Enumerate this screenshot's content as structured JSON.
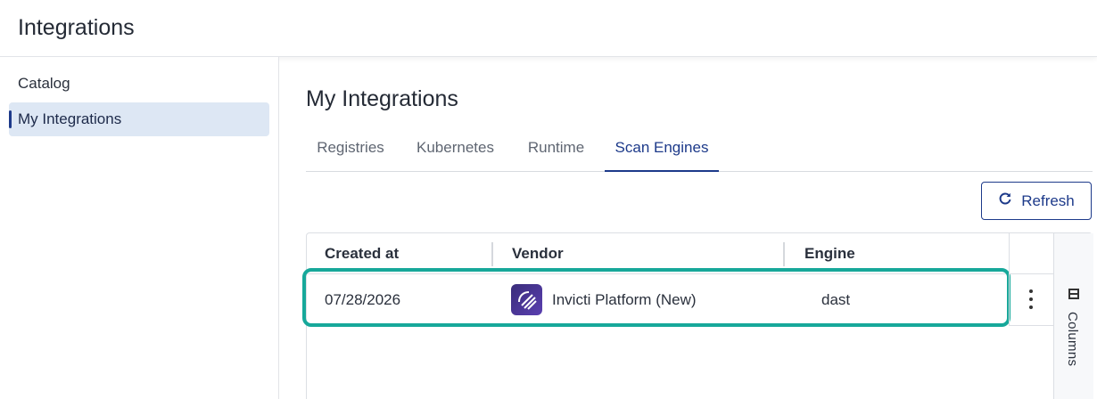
{
  "app": {
    "title": "Integrations"
  },
  "sidebar": {
    "items": [
      {
        "label": "Catalog"
      },
      {
        "label": "My Integrations"
      }
    ]
  },
  "main": {
    "title": "My Integrations",
    "tabs": [
      {
        "label": "Registries"
      },
      {
        "label": "Kubernetes"
      },
      {
        "label": "Runtime"
      },
      {
        "label": "Scan Engines",
        "active": true
      }
    ],
    "refresh_label": "Refresh"
  },
  "table": {
    "columns": [
      "Created at",
      "Vendor",
      "Engine"
    ],
    "rows": [
      {
        "created_at": "07/28/2026",
        "vendor": "Invicti Platform (New)",
        "engine": "dast"
      }
    ],
    "columns_panel_label": "Columns"
  },
  "colors": {
    "accent": "#1d3a8a",
    "highlight": "#17a89a",
    "active_item_bg": "#dde7f4"
  },
  "icons": {
    "refresh": "refresh-icon",
    "kebab": "more-vertical-icon",
    "columns": "columns-icon",
    "vendor_logo": "invicti-logo-icon"
  }
}
